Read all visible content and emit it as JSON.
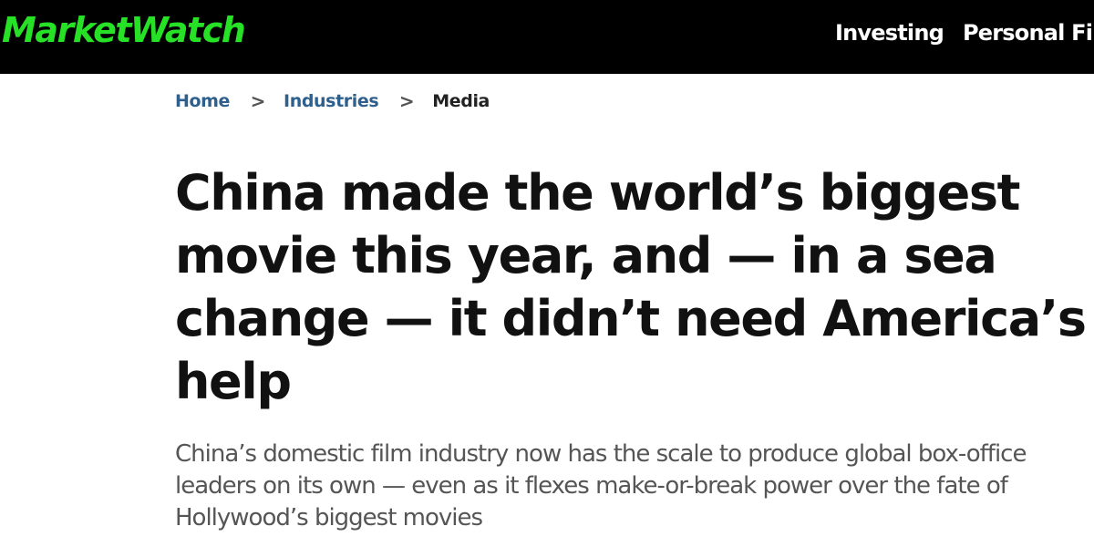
{
  "brand": {
    "name": "MarketWatch",
    "color": "#26e126"
  },
  "nav": {
    "items": [
      "Investing",
      "Personal Fin"
    ]
  },
  "breadcrumb": {
    "items": [
      "Home",
      "Industries",
      "Media"
    ],
    "separator": ">",
    "link_color": "#2f5f8c"
  },
  "article": {
    "headline_lines": [
      "China made the world’s biggest",
      "movie this year, and — in a sea",
      "change — it didn’t need America’s",
      "help"
    ],
    "dek_lines": [
      "China’s domestic film industry now has the scale to produce global box-office",
      "leaders on its own — even as it flexes make-or-break power over the fate of",
      "Hollywood’s biggest movies"
    ]
  }
}
